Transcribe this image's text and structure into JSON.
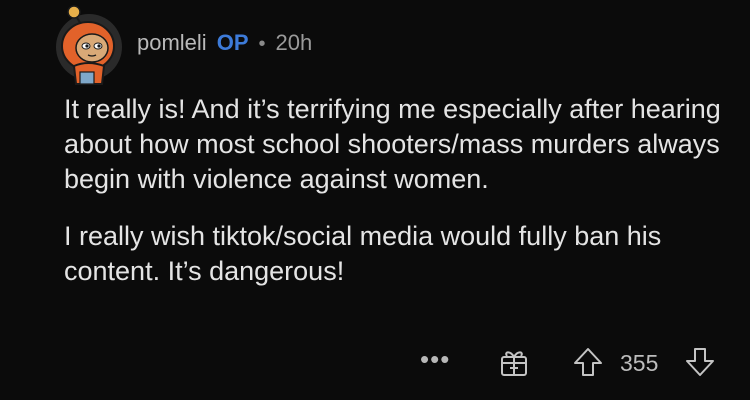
{
  "comment": {
    "author": "pomleli",
    "author_badge": "OP",
    "separator": "•",
    "age": "20h",
    "paragraphs": [
      "It really is! And it’s terrifying me especially after hearing about how most school shooters/mass murders always begin with violence against women.",
      "I really wish tiktok/social media would fully ban his content. It’s dangerous!"
    ],
    "actions": {
      "more_label": "•••",
      "score": "355",
      "icons": {
        "avatar": "snoo-avatar-orange-hood",
        "award": "gift-award-icon",
        "upvote": "upvote-arrow-icon",
        "downvote": "downvote-arrow-icon"
      }
    }
  },
  "colors": {
    "background": "#0b0b0b",
    "text": "#e4e4e4",
    "op_badge": "#3d7bd9",
    "muted": "#9a9a9a"
  }
}
